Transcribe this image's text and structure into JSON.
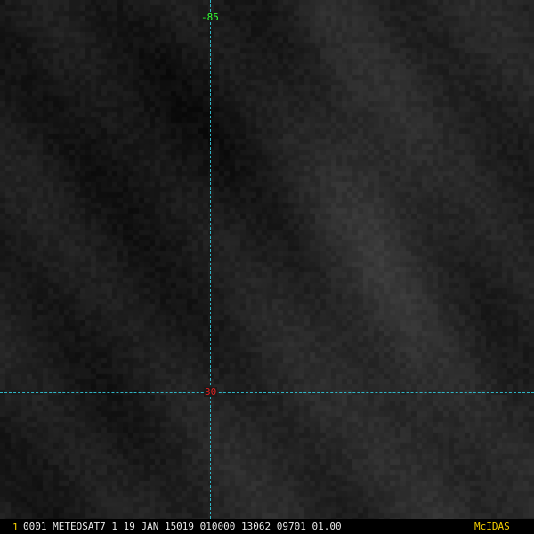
{
  "image": {
    "description_colors": {
      "background": "#1a1a1a",
      "gridline": "#2fb6c6",
      "meridian_label_color": "#33ff33",
      "parallel_label_color": "#e02020",
      "status_text_color": "#e8e8e8",
      "status_accent_color": "#f5d000"
    }
  },
  "gridlines": {
    "meridian_label": "-85",
    "parallel_label": "30"
  },
  "status_bar": {
    "frame_number": "1",
    "info_text": "0001 METEOSAT7  1 19 JAN 15019 010000 13062 09701 01.00",
    "brand": "McIDAS"
  }
}
